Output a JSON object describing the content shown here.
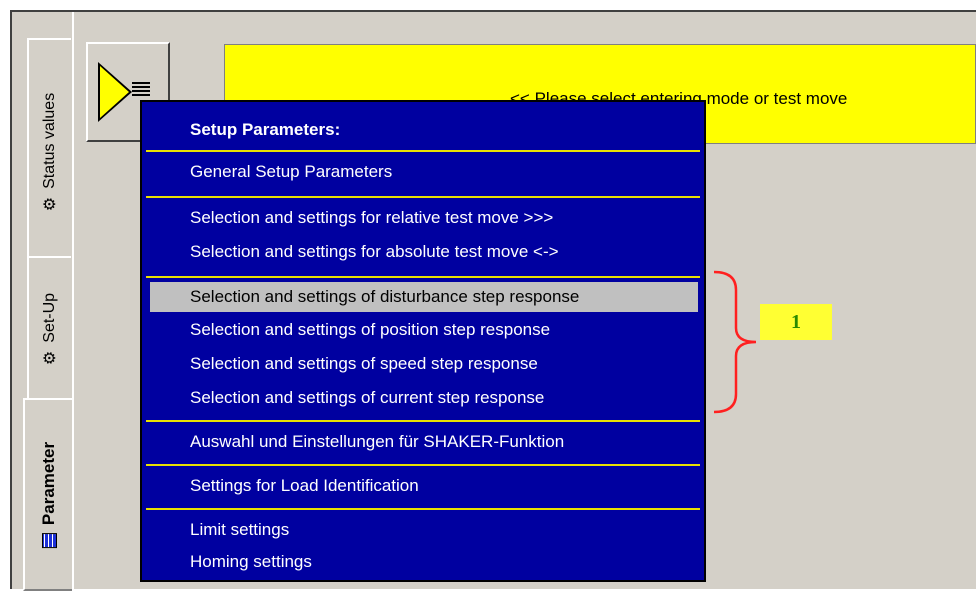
{
  "tabs": [
    {
      "label": "Status values",
      "icon": "gear-icon"
    },
    {
      "label": "Set-Up",
      "icon": "gear-icon"
    },
    {
      "label": "Parameter",
      "icon": "grid-icon",
      "active": true
    }
  ],
  "status_message": "<< Please select entering mode or test move",
  "menu": {
    "title": "Setup Parameters:",
    "groups": [
      [
        "General Setup Parameters"
      ],
      [
        "Selection and settings for relative test move >>>",
        "Selection and settings for absolute test move <->"
      ],
      [
        "Selection and settings of disturbance step response",
        "Selection and settings of position step response",
        "Selection and settings of  speed step response",
        "Selection and settings of  current step response"
      ],
      [
        "Auswahl und Einstellungen für SHAKER-Funktion"
      ],
      [
        "Settings for Load Identification"
      ],
      [
        "Limit settings",
        "Homing settings"
      ]
    ],
    "selected": "Selection and settings of disturbance step response"
  },
  "annotation_label": "1",
  "colors": {
    "menu_bg": "#0000a0",
    "separator": "#e8e000",
    "highlight": "#c0c0c0",
    "banner": "#ffff00",
    "brace": "#ff2020",
    "label_text": "#2a8a00"
  }
}
